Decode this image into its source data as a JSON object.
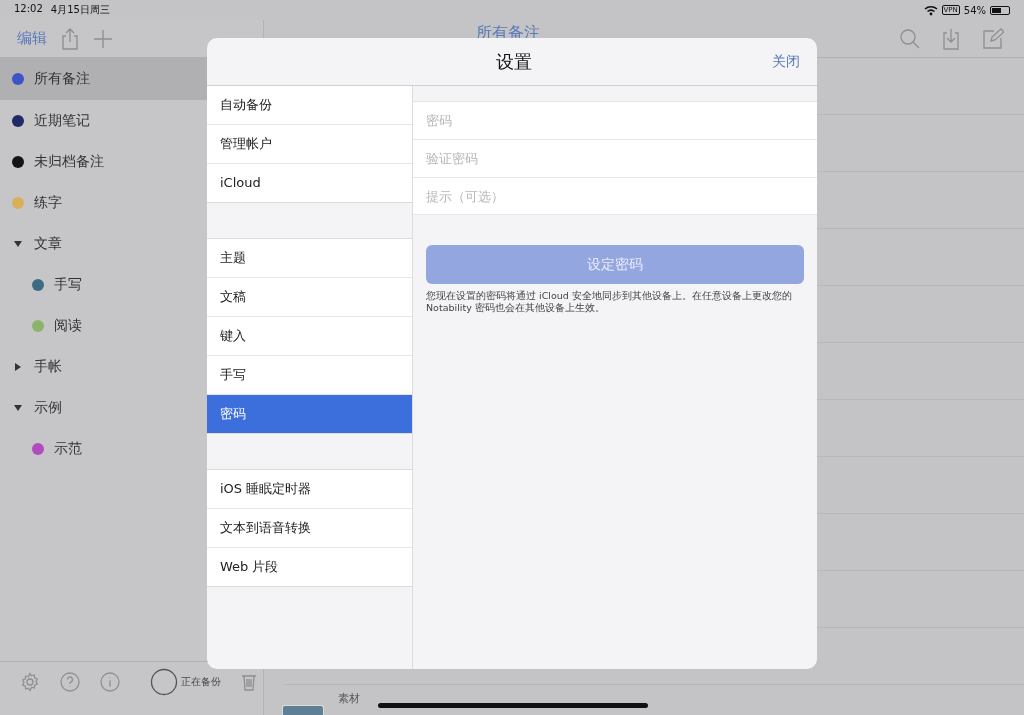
{
  "status_bar": {
    "time": "12:02",
    "date": "4月15日周三",
    "vpn": "VPN",
    "battery": "54%"
  },
  "sidebar": {
    "edit": "编辑",
    "items": [
      {
        "kind": "note",
        "label": "所有备注",
        "color": "#3b55c8",
        "selected": true
      },
      {
        "kind": "note",
        "label": "近期笔记",
        "color": "#1f2a66",
        "selected": false
      },
      {
        "kind": "note",
        "label": "未归档备注",
        "color": "#141414",
        "selected": false
      },
      {
        "kind": "note",
        "label": "练字",
        "color": "#d8b05a",
        "selected": false
      },
      {
        "kind": "folder",
        "label": "文章",
        "expanded": true,
        "selected": false,
        "children": [
          {
            "kind": "note",
            "label": "手写",
            "color": "#3d6b82",
            "selected": false
          },
          {
            "kind": "note",
            "label": "阅读",
            "color": "#8db36a",
            "selected": false
          }
        ]
      },
      {
        "kind": "folder",
        "label": "手帐",
        "expanded": false,
        "selected": false
      },
      {
        "kind": "folder",
        "label": "示例",
        "expanded": true,
        "selected": false,
        "children": [
          {
            "kind": "note",
            "label": "示范",
            "color": "#b04cbf",
            "selected": false
          }
        ]
      }
    ],
    "backup_status": "正在备份"
  },
  "main": {
    "title": "所有备注",
    "note_label": "素材"
  },
  "settings": {
    "title": "设置",
    "close": "关闭",
    "groups": [
      [
        {
          "label": "自动备份",
          "selected": false
        },
        {
          "label": "管理帐户",
          "selected": false
        },
        {
          "label": "iCloud",
          "selected": false
        }
      ],
      [
        {
          "label": "主题",
          "selected": false
        },
        {
          "label": "文稿",
          "selected": false
        },
        {
          "label": "键入",
          "selected": false
        },
        {
          "label": "手写",
          "selected": false
        },
        {
          "label": "密码",
          "selected": true
        }
      ],
      [
        {
          "label": "iOS 睡眠定时器",
          "selected": false
        },
        {
          "label": "文本到语音转换",
          "selected": false
        },
        {
          "label": "Web 片段",
          "selected": false
        }
      ]
    ],
    "fields": [
      {
        "placeholder": "密码"
      },
      {
        "placeholder": "验证密码"
      },
      {
        "placeholder": "提示（可选）"
      }
    ],
    "button": {
      "label": "设定密码",
      "disabled": true
    },
    "note": "您现在设置的密码将通过 iCloud 安全地同步到其他设备上。在任意设备上更改您的 Notability 密码也会在其他设备上生效。"
  }
}
